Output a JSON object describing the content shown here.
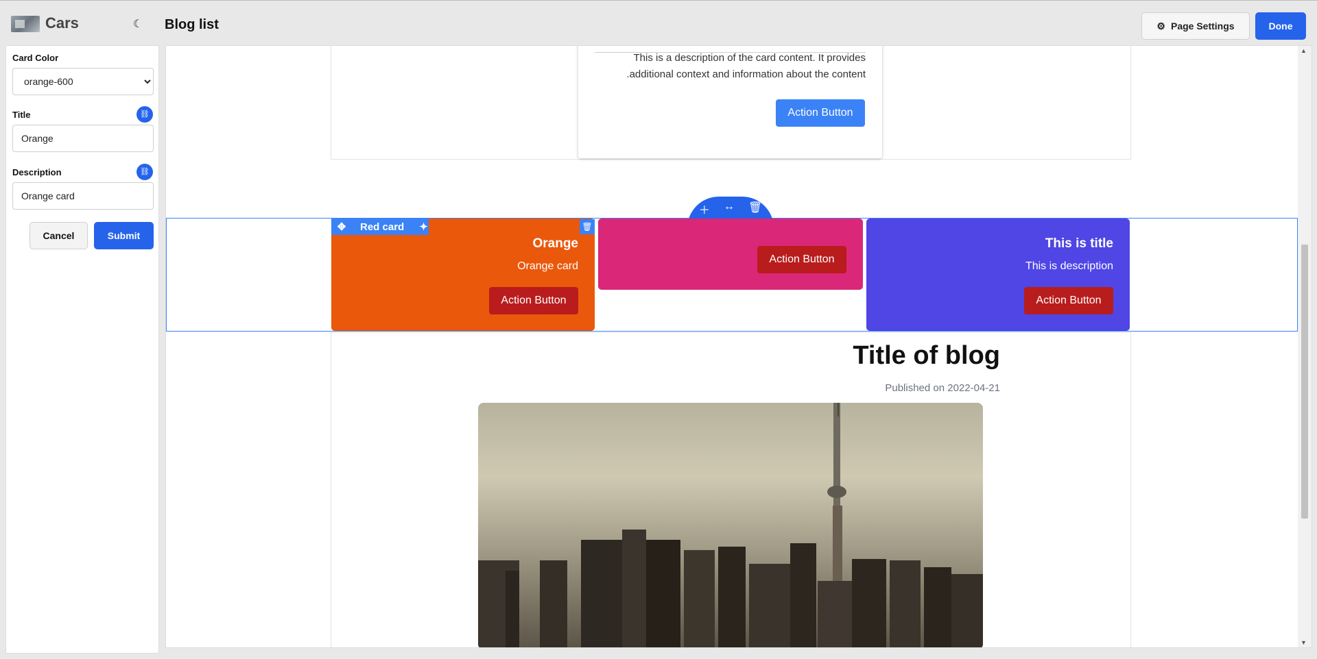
{
  "app": {
    "name": "Cars"
  },
  "header": {
    "page_title": "Blog list",
    "settings_label": "Page Settings",
    "done_label": "Done"
  },
  "sidebar": {
    "card_color_label": "Card Color",
    "card_color_value": "orange-600",
    "card_color_options": [
      "orange-600"
    ],
    "title_label": "Title",
    "title_value": "Orange",
    "description_label": "Description",
    "description_value": "Orange card",
    "cancel_label": "Cancel",
    "submit_label": "Submit"
  },
  "canvas": {
    "top_card": {
      "description": "This is a description of the card content. It provides additional context and information about the content.",
      "button_label": "Action Button"
    },
    "cards": [
      {
        "name_tag": "Red card",
        "title": "Orange",
        "description": "Orange card",
        "button_label": "Action Button",
        "color": "#ea580c"
      },
      {
        "button_label": "Action Button",
        "color": "#db2777"
      },
      {
        "title": "This is title",
        "description": "This is description",
        "button_label": "Action Button",
        "color": "#4f46e5"
      }
    ],
    "blog": {
      "title": "Title of blog",
      "published": "Published on 2022-04-21"
    }
  },
  "colors": {
    "primary": "#2563eb",
    "action_red": "#b91c1c",
    "action_blue": "#3b82f6"
  }
}
